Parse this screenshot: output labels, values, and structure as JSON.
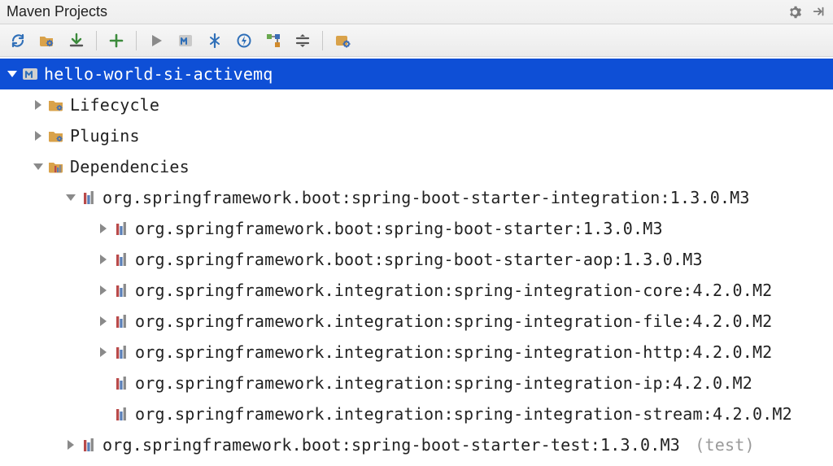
{
  "panel": {
    "title": "Maven Projects"
  },
  "tree": {
    "project": {
      "name": "hello-world-si-activemq",
      "nodes": {
        "lifecycle": {
          "label": "Lifecycle"
        },
        "plugins": {
          "label": "Plugins"
        },
        "deps": {
          "label": "Dependencies"
        }
      }
    },
    "deps": [
      {
        "coords": "org.springframework.boot:spring-boot-starter-integration:1.3.0.M3",
        "children": [
          {
            "coords": "org.springframework.boot:spring-boot-starter:1.3.0.M3",
            "has_children": true
          },
          {
            "coords": "org.springframework.boot:spring-boot-starter-aop:1.3.0.M3",
            "has_children": true
          },
          {
            "coords": "org.springframework.integration:spring-integration-core:4.2.0.M2",
            "has_children": true
          },
          {
            "coords": "org.springframework.integration:spring-integration-file:4.2.0.M2",
            "has_children": true
          },
          {
            "coords": "org.springframework.integration:spring-integration-http:4.2.0.M2",
            "has_children": true
          },
          {
            "coords": "org.springframework.integration:spring-integration-ip:4.2.0.M2",
            "has_children": false
          },
          {
            "coords": "org.springframework.integration:spring-integration-stream:4.2.0.M2",
            "has_children": false
          }
        ]
      },
      {
        "coords": "org.springframework.boot:spring-boot-starter-test:1.3.0.M3",
        "scope": "(test)",
        "has_children": true
      }
    ]
  }
}
